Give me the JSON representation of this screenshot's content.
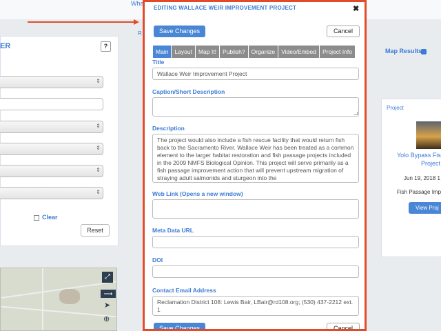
{
  "background": {
    "top_link": "Wha",
    "left_panel_title": "ER",
    "help_label": "?",
    "clear_label": "Clear",
    "reset_label": "Reset",
    "mid_label": "R",
    "map_results_label": "Map Results",
    "card": {
      "label": "Project",
      "title_line1": "Yolo Bypass Fis",
      "title_line2": "Project",
      "date": "Jun 19, 2018 1",
      "category": "Fish Passage Imp",
      "view_button": "View Proj"
    }
  },
  "modal": {
    "title": "EDITING WALLACE WEIR IMPROVEMENT PROJECT",
    "close_glyph": "✖",
    "save_label": "Save Changes",
    "cancel_label": "Cancel",
    "tabs": [
      {
        "label": "Main",
        "active": true
      },
      {
        "label": "Layout"
      },
      {
        "label": "Map It!"
      },
      {
        "label": "Publish?"
      },
      {
        "label": "Organize"
      },
      {
        "label": "Video/Embed"
      },
      {
        "label": "Project Info"
      }
    ],
    "fields": {
      "title_label": "Title",
      "title_value": "Wallace Weir Improvement Project",
      "caption_label": "Caption/Short Description",
      "caption_value": "",
      "description_label": "Description",
      "description_value": "The project would also include a fish rescue facility that would return fish back to the Sacramento River. Wallace Weir has been treated as a common element to the larger habitat restoration and fish passage projects included in the 2009 NMFS Biological Opinion. This project will serve primarily as a fish passage improvement action that will prevent upstream migration of straying adult salmonids and sturgeon into the",
      "weblink_label": "Web Link (Opens a new window)",
      "weblink_value": "",
      "metadata_label": "Meta Data URL",
      "metadata_value": "",
      "doi_label": "DOI",
      "doi_value": "",
      "email_label": "Contact Email Address",
      "email_value": "Reclamation District 108: Lewis Bair, LBair@rd108.org; (530) 437-2212 ext. 1"
    }
  },
  "colors": {
    "accent": "#4a86d6",
    "highlight_border": "#e14b2a",
    "tab_inactive": "#8c8c8c"
  }
}
